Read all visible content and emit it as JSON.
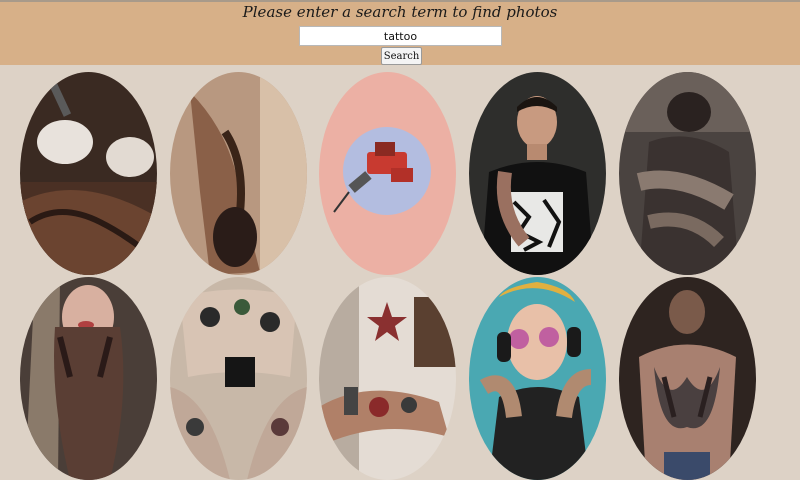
{
  "header": {
    "prompt": "Please enter a search term to find photos",
    "search_value": "tattoo",
    "search_button_label": "Search",
    "background_color": "#d7b088"
  },
  "results": {
    "photos": [
      {
        "subject": "tattoo artist working on tattooed arm"
      },
      {
        "subject": "tattooed arm with hand"
      },
      {
        "subject": "red tattoo machine on pink background"
      },
      {
        "subject": "tattooed man in black t-shirt"
      },
      {
        "subject": "tattoo artist at work"
      },
      {
        "subject": "tattooed woman with hand on face"
      },
      {
        "subject": "close-up of tattooed legs"
      },
      {
        "subject": "tattooed arm holding tattoo machine"
      },
      {
        "subject": "smiling woman with headphones and sunglasses"
      },
      {
        "subject": "man with back tattoo"
      }
    ]
  }
}
